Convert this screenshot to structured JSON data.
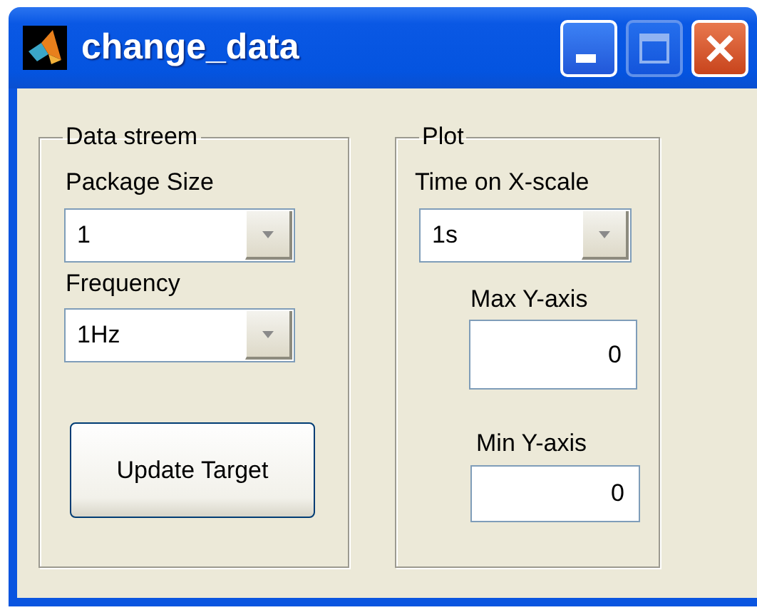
{
  "window": {
    "title": "change_data",
    "buttons": [
      {
        "kind": "minimize",
        "disabled": false
      },
      {
        "kind": "maximize",
        "disabled": true
      },
      {
        "kind": "close",
        "disabled": false
      }
    ]
  },
  "panels": [
    {
      "title": "Data streem",
      "controls": [
        {
          "kind": "label",
          "text": "Package Size"
        },
        {
          "kind": "dropdown",
          "value": "1"
        },
        {
          "kind": "label",
          "text": "Frequency"
        },
        {
          "kind": "dropdown",
          "value": "1Hz"
        },
        {
          "kind": "button",
          "label": "Update Target"
        }
      ]
    },
    {
      "title": "Plot",
      "controls": [
        {
          "kind": "label",
          "text": "Time on X-scale"
        },
        {
          "kind": "dropdown",
          "value": "1s"
        },
        {
          "kind": "label",
          "text": "Max Y-axis"
        },
        {
          "kind": "edit",
          "value": "0"
        },
        {
          "kind": "label",
          "text": "Min Y-axis"
        },
        {
          "kind": "edit",
          "value": "0"
        }
      ]
    }
  ]
}
